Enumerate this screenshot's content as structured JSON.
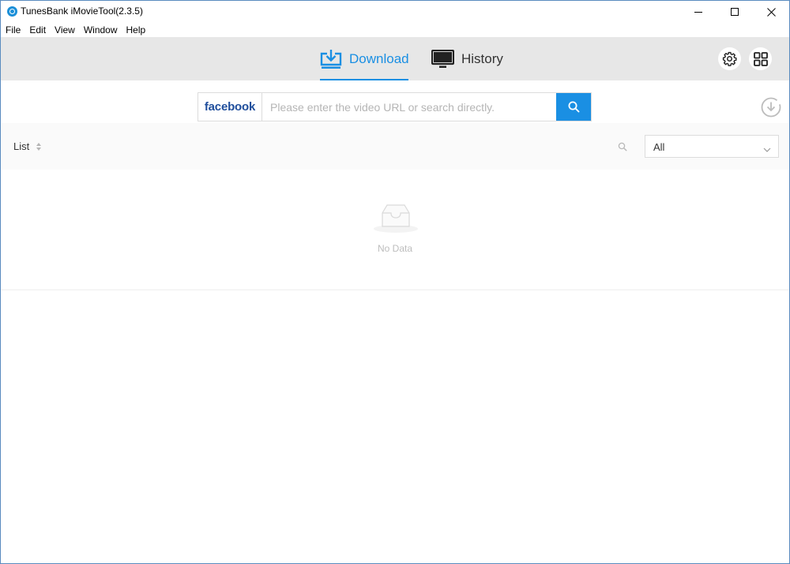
{
  "window": {
    "title": "TunesBank iMovieTool(2.3.5)"
  },
  "menu": [
    "File",
    "Edit",
    "View",
    "Window",
    "Help"
  ],
  "tabs": {
    "download": "Download",
    "history": "History",
    "active": "download"
  },
  "search": {
    "site": "facebook",
    "placeholder": "Please enter the video URL or search directly.",
    "value": ""
  },
  "list": {
    "label": "List",
    "filter_value": "All"
  },
  "empty": {
    "text": "No Data"
  },
  "colors": {
    "accent": "#1a8fe3",
    "header_bg": "#e7e7e7",
    "facebook": "#1f4e9c"
  },
  "icons": {
    "download_tab": "download-tray-icon",
    "history_tab": "monitor-icon",
    "settings": "gear-icon",
    "grid": "grid-icon",
    "search": "search-icon",
    "download_queue": "download-circle-icon",
    "sort": "sort-icon",
    "empty": "inbox-icon"
  }
}
